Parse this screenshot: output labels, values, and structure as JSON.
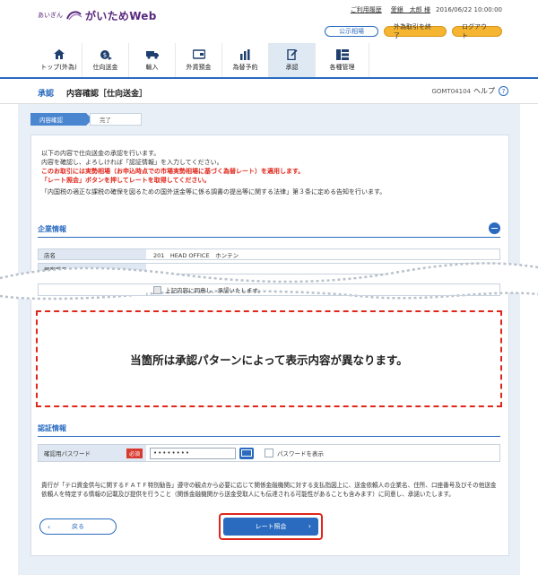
{
  "header": {
    "bank_label": "あいぎん",
    "brand": "がいためWeb",
    "history_link": "ご利用履歴",
    "user_name": "愛銀　太郎 様",
    "datetime": "2016/06/22 10:00:00",
    "buttons": {
      "rates": "公示相場",
      "end_fx": "外為取引を終了",
      "logout": "ログアウト"
    }
  },
  "nav": [
    {
      "label": "トップ(外為)",
      "icon": "home-icon"
    },
    {
      "label": "仕向送金",
      "icon": "remit-icon"
    },
    {
      "label": "輸入",
      "icon": "import-icon"
    },
    {
      "label": "外貨預金",
      "icon": "deposit-icon"
    },
    {
      "label": "為替予約",
      "icon": "forward-icon"
    },
    {
      "label": "承認",
      "icon": "approve-icon",
      "active": true
    },
    {
      "label": "各種管理",
      "icon": "manage-icon"
    }
  ],
  "title": {
    "section": "承認",
    "page": "内容確認［仕向送金］",
    "code": "GOMT04104",
    "help": "ヘルプ"
  },
  "steps": [
    "内容確認",
    "完了"
  ],
  "message": {
    "line1": "以下の内容で仕向送金の承認を行います。",
    "line2": "内容を確認し、よろしければ「認証情報」を入力してください。",
    "red1": "このお取引には実勢相場（お申込時点での市場実勢相場に基づく為替レート）を適用します。",
    "red2": "「レート照会」ボタンを押してレートを取得してください。",
    "law": "「内国税の適正な課税の確保を図るための国外送金等に係る調書の提出等に関する法律」第３条に定める告知を行います。"
  },
  "company": {
    "heading": "企業情報",
    "rows": [
      {
        "label": "店名",
        "value": "201　HEAD OFFICE　ホンテン"
      },
      {
        "label": "顧客番号",
        "value": ""
      }
    ],
    "agree_text": "上記内容に同意し、承認いたします。"
  },
  "placeholder_note": "当箇所は承認パターンによって表示内容が異なります。",
  "auth": {
    "heading": "認証情報",
    "pw_label": "確認用パスワード",
    "required": "必須",
    "pw_value": "••••••••",
    "show_pw": "パスワードを表示"
  },
  "notice": "貴行が「テロ資金供与に関するＦＡＴＦ特別勧告」遵守の観点から必要に応じて関係金融機関に対する支払指図上に、送金依頼人の企業名、住所、口座番号及びその他送金依頼人を特定する情報の記載及び提供を行うこと（関係金融機関から送金受取人にも伝達される可能性があることも含みます）に同意し、承諾いたします。",
  "actions": {
    "back": "戻る",
    "rate": "レート照会"
  }
}
